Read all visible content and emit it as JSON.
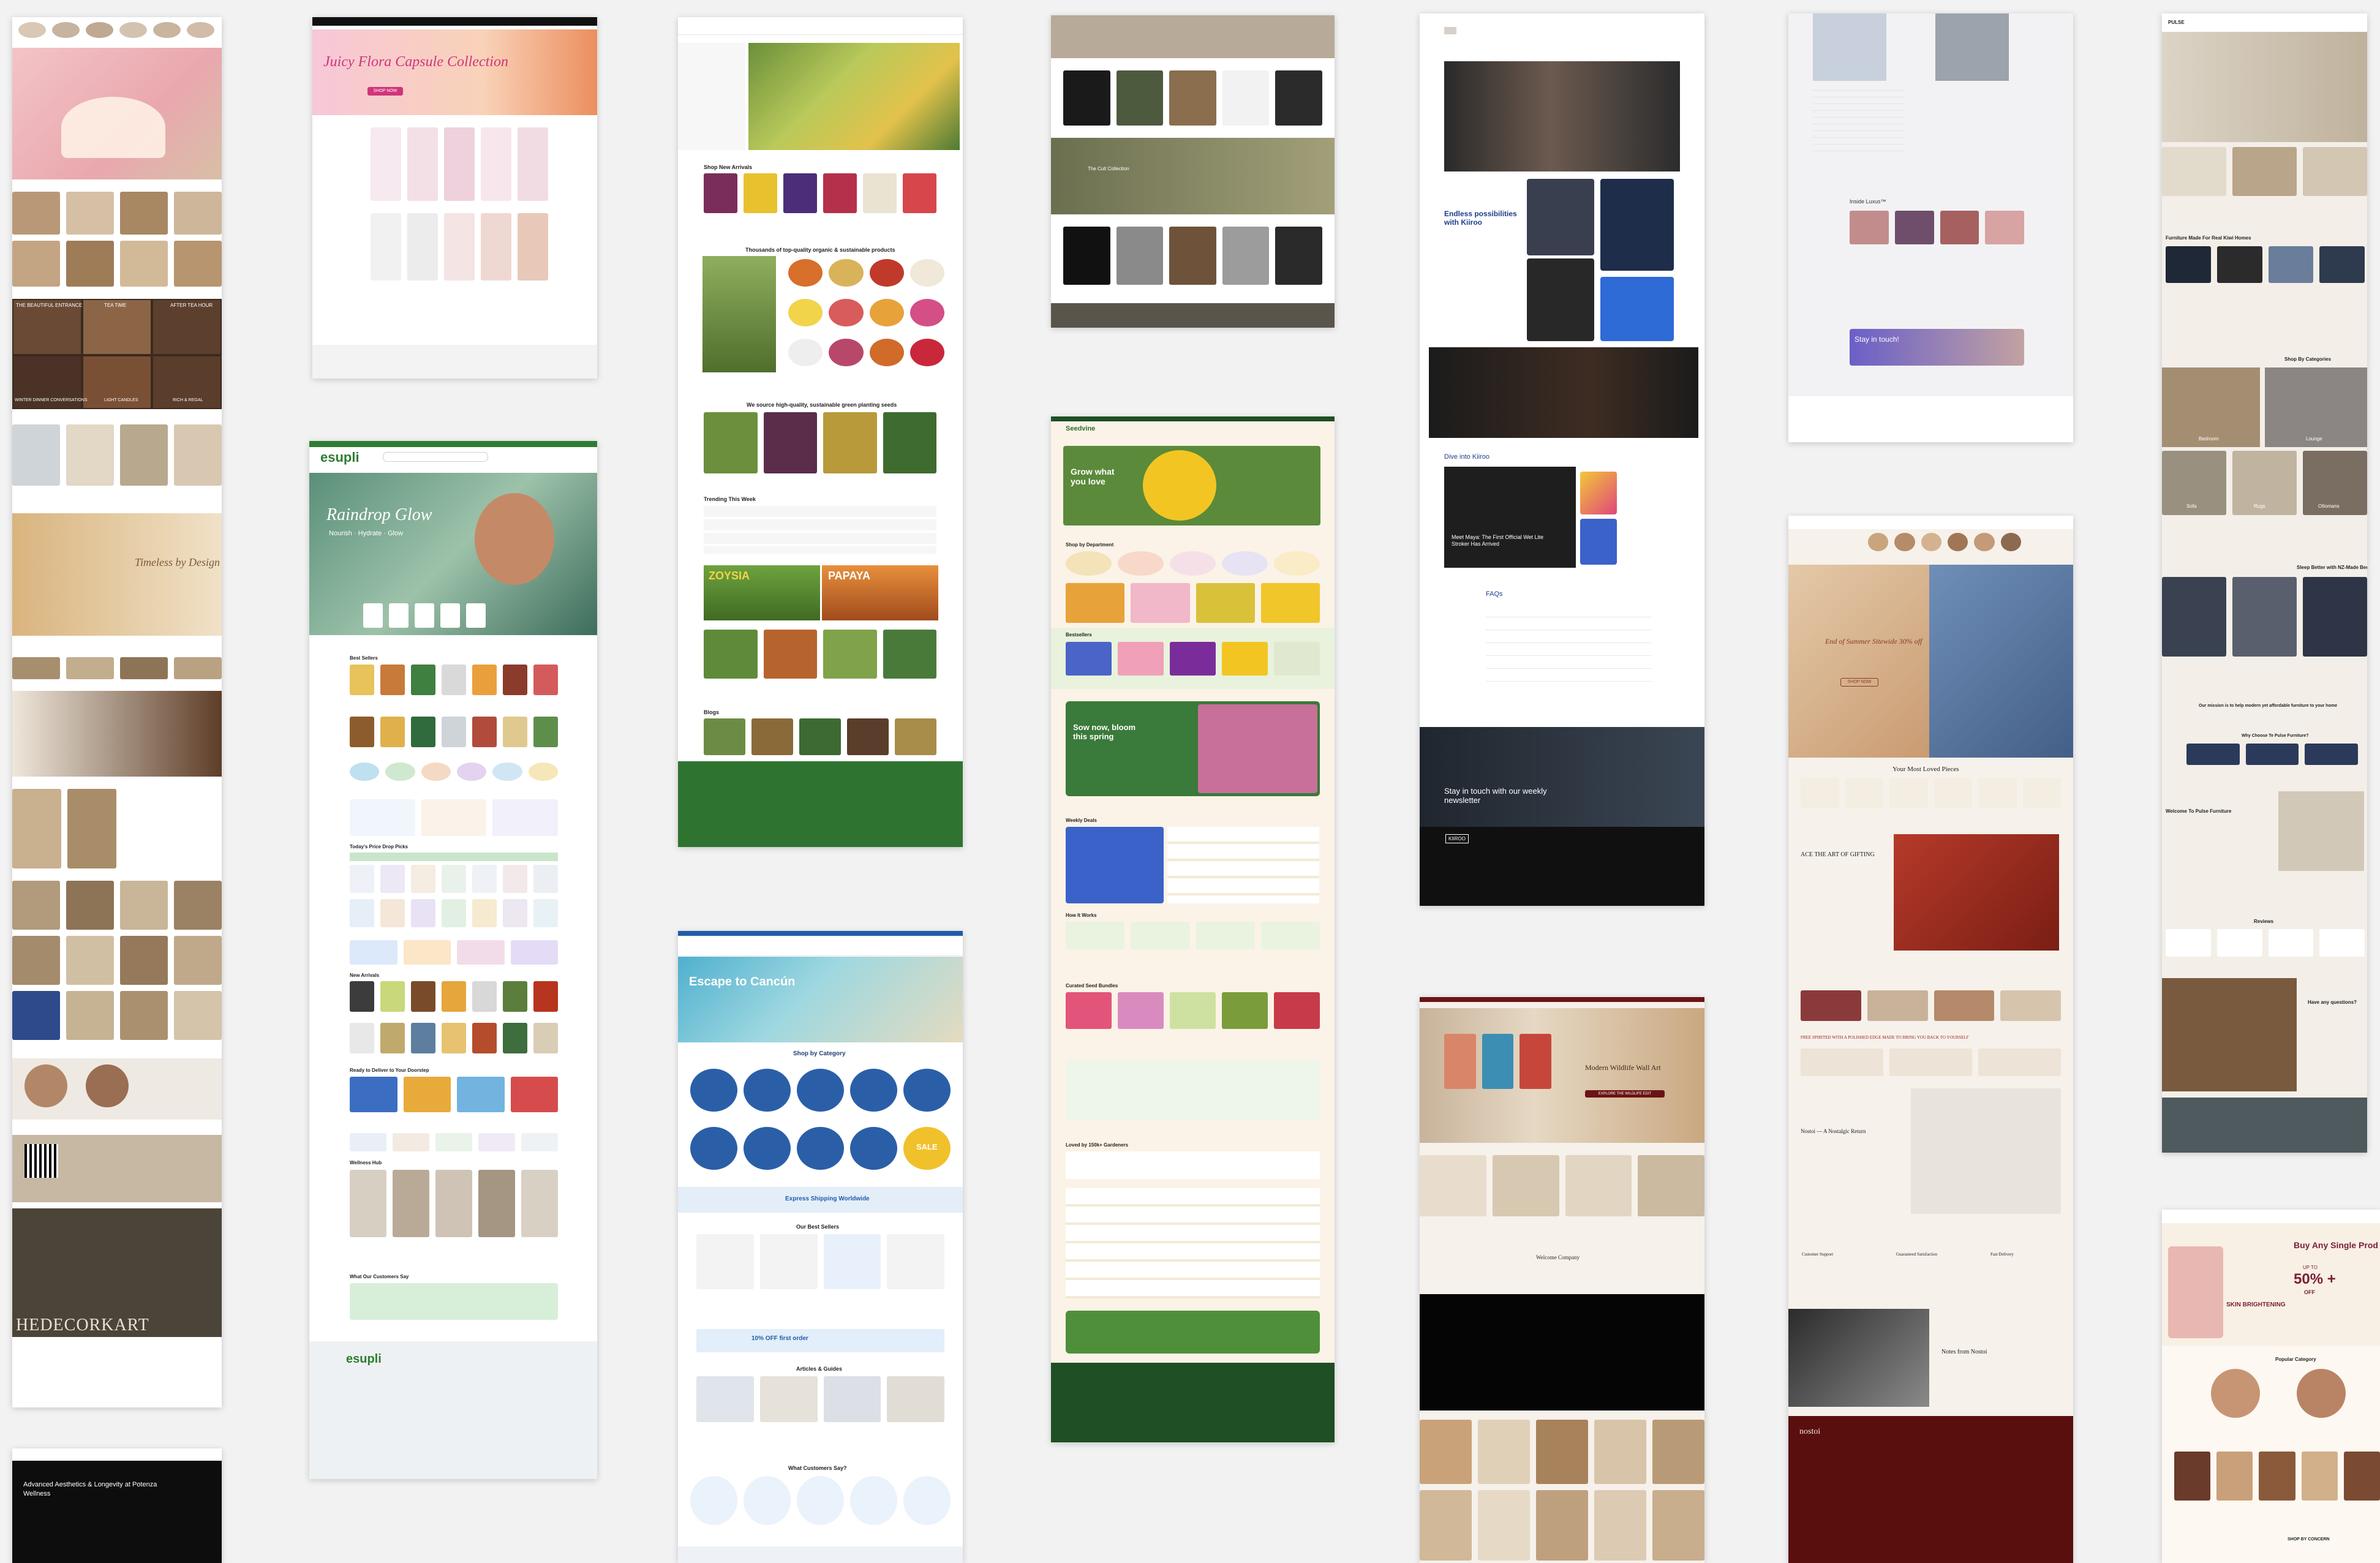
{
  "col1": {
    "banner_a": "THE BEAUTIFUL ENTRANCE",
    "banner_b": "TEA TIME",
    "banner_c": "AFTER TEA HOUR",
    "banner_d": "WINTER DINNER CONVERSATIONS",
    "banner_e": "LIGHT CANDLES",
    "banner_f": "RICH & REGAL",
    "timeless_title": "Timeless by Design",
    "brand": "HEDECORKART",
    "wellness_title": "Advanced Aesthetics & Longevity at Potenza Wellness"
  },
  "col2": {
    "flora_title": "Juicy Flora Capsule Collection",
    "shop_now": "SHOP NOW",
    "esupli_logo": "esupli",
    "hero_title": "Raindrop Glow",
    "hero_sub": "Nourish · Hydrate · Glow",
    "best_sellers": "Best Sellers",
    "today_deals": "Today's Price Drop Picks",
    "new_arrivals": "New Arrivals",
    "ready_deliver": "Ready to Deliver to Your Doorstep",
    "wellness_hub": "Wellness Hub",
    "customers_say": "What Our Customers Say",
    "footer_logo": "esupli"
  },
  "col3": {
    "shop_new_arrivals": "Shop New Arrivals",
    "thousands": "Thousands of top-quality organic & sustainable products",
    "seeds_intro": "We source high-quality, sustainable green planting seeds",
    "trending": "Trending This Week",
    "zoysia": "ZOYSIA",
    "papaya": "PAPAYA",
    "blogs": "Blogs",
    "escape_title": "Escape to Cancún",
    "shop_by_category": "Shop by Category",
    "sale": "SALE",
    "express": "Express Shipping Worldwide",
    "best_sellers": "Our Best Sellers",
    "offer": "10% OFF first order",
    "articles": "Articles & Guides",
    "what_say": "What Customers Say?"
  },
  "col4": {
    "cult_collection": "The Cult Collection",
    "seedlogo": "Seedvine",
    "grow_title": "Grow what you love",
    "shop_by_department": "Shop by Department",
    "bestsellers": "Bestsellers",
    "sow_title": "Sow now, bloom this spring",
    "weekly_deals": "Weekly Deals",
    "how_it_works": "How It Works",
    "curated": "Curated Seed Bundles",
    "loved_by": "Loved by 150k+ Gardeners"
  },
  "col5": {
    "endless_title": "Endless possibilities with Kiiroo",
    "dive_into": "Dive into Kiiroo",
    "maya_title": "Meet Maya: The First Official Wet Lite Stroker Has Arrived",
    "faqs": "FAQs",
    "stay_touch": "Stay in touch with our weekly newsletter",
    "kiiroo_logo": "KIIROO",
    "wall_art_title": "Modern Wildlife Wall Art",
    "explore_btn": "EXPLORE THE WILDLIFE EDIT",
    "welcome": "Welcome Company"
  },
  "col6": {
    "inside_title": "Inside Luxus™",
    "stay_touch": "Stay in touch!",
    "end_summer": "End of Summer Sitewide 30% off",
    "shop_now": "SHOP NOW",
    "most_loved": "Your Most Loved Pieces",
    "gifting": "ACE THE ART OF GIFTING",
    "free_spirited": "FREE SPIRITED WITH A POLISHED EDGE MADE TO BRING YOU BACK TO YOURSELF",
    "nostoi_return": "Nostoi — A Nostalgic Return",
    "customer_support": "Customer Support",
    "guaranteed": "Guaranteed Satisfaction",
    "delivery": "Fast Delivery",
    "notes_from": "Notes from Nostoi",
    "nostoi_logo": "nostoi"
  },
  "col7": {
    "pulse_brand": "PULSE",
    "furniture_title": "Furniture Made For Real Kiwi Homes",
    "shop_by_categories": "Shop By Categories",
    "bedroom": "Bedroom",
    "lounge": "Lounge",
    "sofa": "Sofa",
    "rugs": "Rugs",
    "ottomans": "Ottomans",
    "sleep_better": "Sleep Better with NZ-Made Beds",
    "mission": "Our mission is to help modern yet affordable furniture to your home",
    "why_choose": "Why Choose Te Pulse Furniture?",
    "welcome": "Welcome To Pulse Furniture",
    "reviews": "Reviews",
    "questions": "Have any questions?",
    "buy_any": "Buy Any Single Prod",
    "upto": "UP TO",
    "percent": "50% +",
    "off": "OFF",
    "skin": "SKIN BRIGHTENING",
    "popular": "Popular Category",
    "shop_concern": "SHOP BY CONCERN"
  }
}
